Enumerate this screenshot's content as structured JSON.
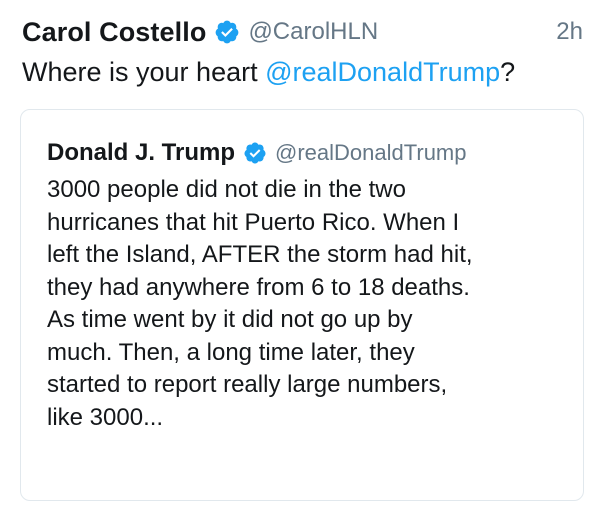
{
  "tweet": {
    "author_name": "Carol Costello",
    "author_handle": "@CarolHLN",
    "timestamp": "2h",
    "text_prefix": "Where is your heart ",
    "mention": "@realDonaldTrump",
    "text_suffix": "?",
    "verified_icon": "verified-badge-icon"
  },
  "quoted_tweet": {
    "author_name": "Donald J. Trump",
    "author_handle": "@realDonaldTrump",
    "verified_icon": "verified-badge-icon",
    "text_lines": [
      "3000 people did not die in the two",
      "hurricanes that hit Puerto Rico. When I",
      "left the Island, AFTER the storm had hit,",
      "they had anywhere from 6 to 18 deaths.",
      "As time went by it did not go up by",
      "much. Then, a long time later, they",
      "started to report really large numbers,",
      "like 3000..."
    ]
  },
  "colors": {
    "verified_blue": "#1da1f2",
    "mention_blue": "#1da1f2",
    "secondary_gray": "#657786",
    "border_gray": "#e1e8ed"
  }
}
